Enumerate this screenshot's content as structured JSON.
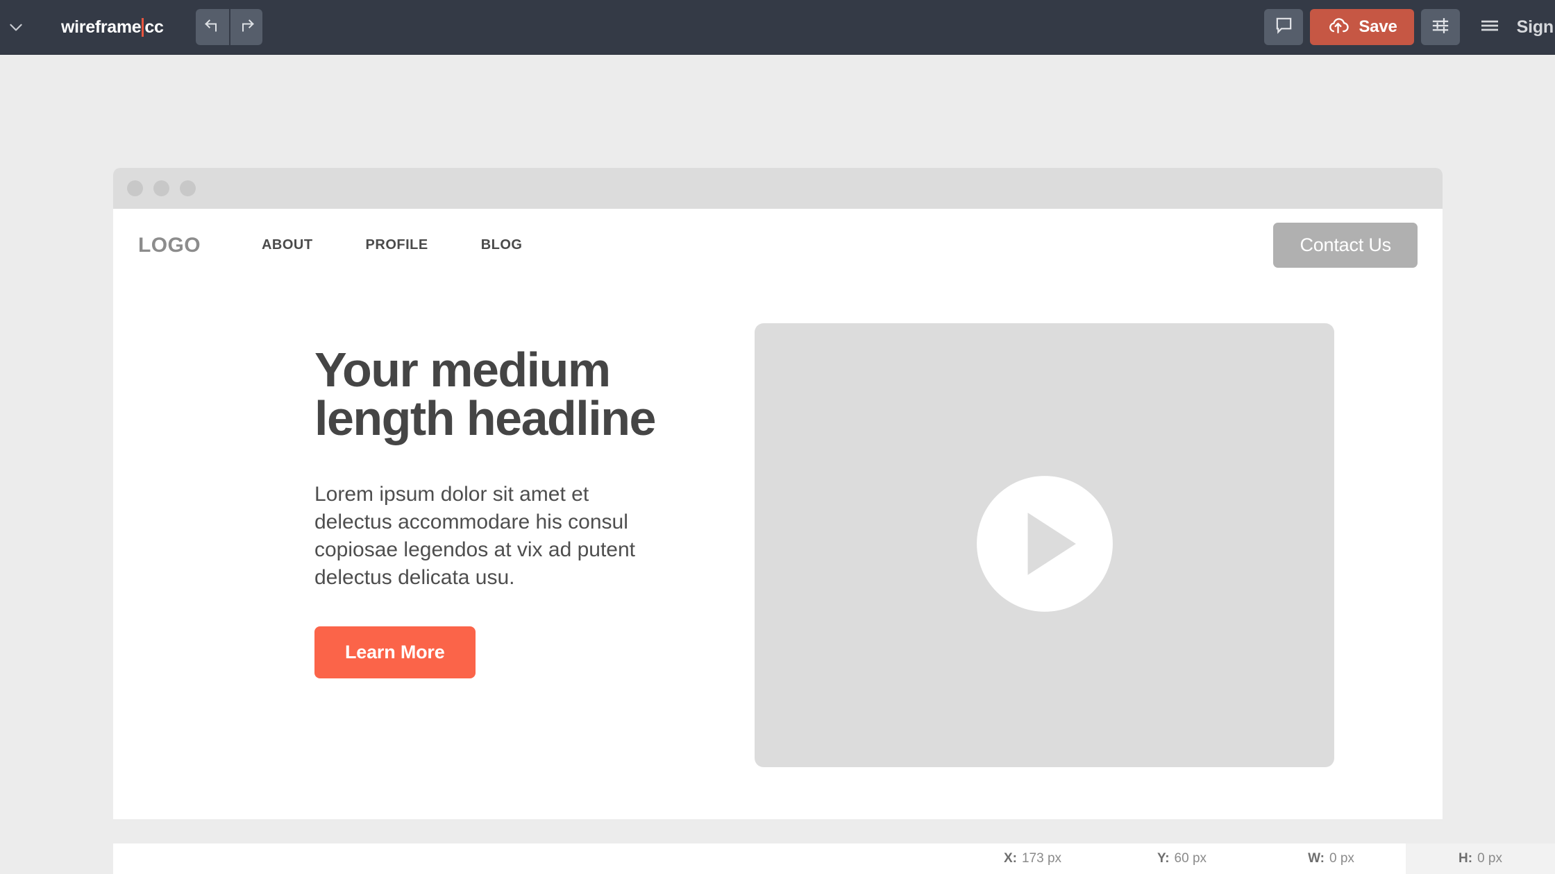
{
  "toolbar": {
    "collapse_icon": "chevron-down-icon",
    "project_name_left": "wireframe",
    "project_name_right": "cc",
    "caret_color": "#e8553f",
    "undo_icon": "undo-arrow-icon",
    "redo_icon": "redo-arrow-icon",
    "comment_icon": "comment-bubble-icon",
    "save_icon": "cloud-upload-icon",
    "save_label": "Save",
    "save_color": "#c65744",
    "settings_icon": "sliders-icon",
    "menu_icon": "hamburger-menu-icon",
    "signin_label": "Sign"
  },
  "artboard": {
    "chrome": {
      "dots": [
        "dot-1",
        "dot-2",
        "dot-3"
      ]
    },
    "nav": {
      "logo": "LOGO",
      "links": [
        {
          "label": "ABOUT"
        },
        {
          "label": "PROFILE"
        },
        {
          "label": "BLOG"
        }
      ],
      "cta_label": "Contact Us",
      "cta_color": "#b0b0b0"
    },
    "hero": {
      "headline": "Your medium length headline",
      "body": "Lorem ipsum dolor sit amet et delectus accommodare his consul copiosae legendos at vix ad putent delectus delicata usu.",
      "button_label": "Learn More",
      "button_color": "#fb6449",
      "media": {
        "icon": "play-button-icon",
        "fill": "#dcdcdc"
      }
    }
  },
  "status_bar": {
    "fields": [
      {
        "key": "X:",
        "value": "173 px",
        "highlight": false
      },
      {
        "key": "Y:",
        "value": "60 px",
        "highlight": false
      },
      {
        "key": "W:",
        "value": "0 px",
        "highlight": false
      },
      {
        "key": "H:",
        "value": "0 px",
        "highlight": true
      }
    ]
  }
}
